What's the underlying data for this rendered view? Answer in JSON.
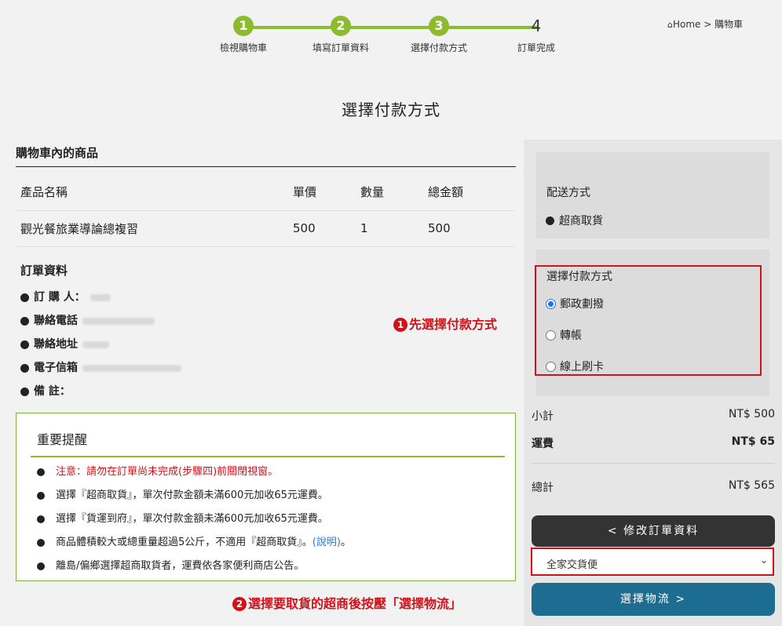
{
  "stepper": {
    "steps": [
      {
        "num": "1",
        "label": "檢視購物車"
      },
      {
        "num": "2",
        "label": "填寫訂單資料"
      },
      {
        "num": "3",
        "label": "選擇付款方式"
      },
      {
        "num": "4",
        "label": "訂單完成"
      }
    ]
  },
  "breadcrumb": {
    "home": "Home",
    "sep": ">",
    "current": "購物車"
  },
  "page_title": "選擇付款方式",
  "cart": {
    "heading": "購物車內的商品",
    "columns": [
      "產品名稱",
      "單價",
      "數量",
      "總金額"
    ],
    "rows": [
      {
        "name": "觀光餐旅業導論總複習",
        "price": "500",
        "qty": "1",
        "total": "500"
      }
    ]
  },
  "order_info": {
    "title": "訂單資料",
    "fields": [
      {
        "label": "訂 購 人："
      },
      {
        "label": "聯絡電話"
      },
      {
        "label": "聯絡地址"
      },
      {
        "label": "電子信箱"
      },
      {
        "label": "備 註："
      }
    ]
  },
  "notice": {
    "title": "重要提醒",
    "items": [
      {
        "text": "注意：請勿在訂單尚未完成(步驟四)前關閉視窗。"
      },
      {
        "text": "選擇『超商取貨』，單次付款金額未滿600元加收65元運費。"
      },
      {
        "text": "選擇『貨運到府』，單次付款金額未滿600元加收65元運費。"
      },
      {
        "text": "商品體積較大或總重量超過5公斤，不適用『超商取貨』。",
        "link": "(說明)",
        "after": "。"
      },
      {
        "text": "離島/偏鄉選擇超商取貨者，運費依各家便利商店公告。"
      }
    ]
  },
  "annotations": {
    "one_num": "1",
    "one_text": "先選擇付款方式",
    "two_num": "2",
    "two_text": "選擇要取貨的超商後按壓「選擇物流」"
  },
  "shipping": {
    "title": "配送方式",
    "selected": "超商取貨"
  },
  "payment": {
    "title": "選擇付款方式",
    "options": [
      "郵政劃撥",
      "轉帳",
      "線上刷卡"
    ],
    "selected_index": 0
  },
  "summary": {
    "subtotal_label": "小計",
    "subtotal_value": "NT$ 500",
    "shipping_label": "運費",
    "shipping_value": "NT$ 65",
    "total_label": "總計",
    "total_value": "NT$ 565"
  },
  "buttons": {
    "edit_order": "< 修改訂單資料",
    "store_select_value": "全家交貨便",
    "choose_logistics": "選擇物流 >"
  },
  "colors": {
    "accent_green": "#8dbb2e",
    "annotation_red": "#d0121b",
    "primary_blue": "#1d6d91"
  }
}
